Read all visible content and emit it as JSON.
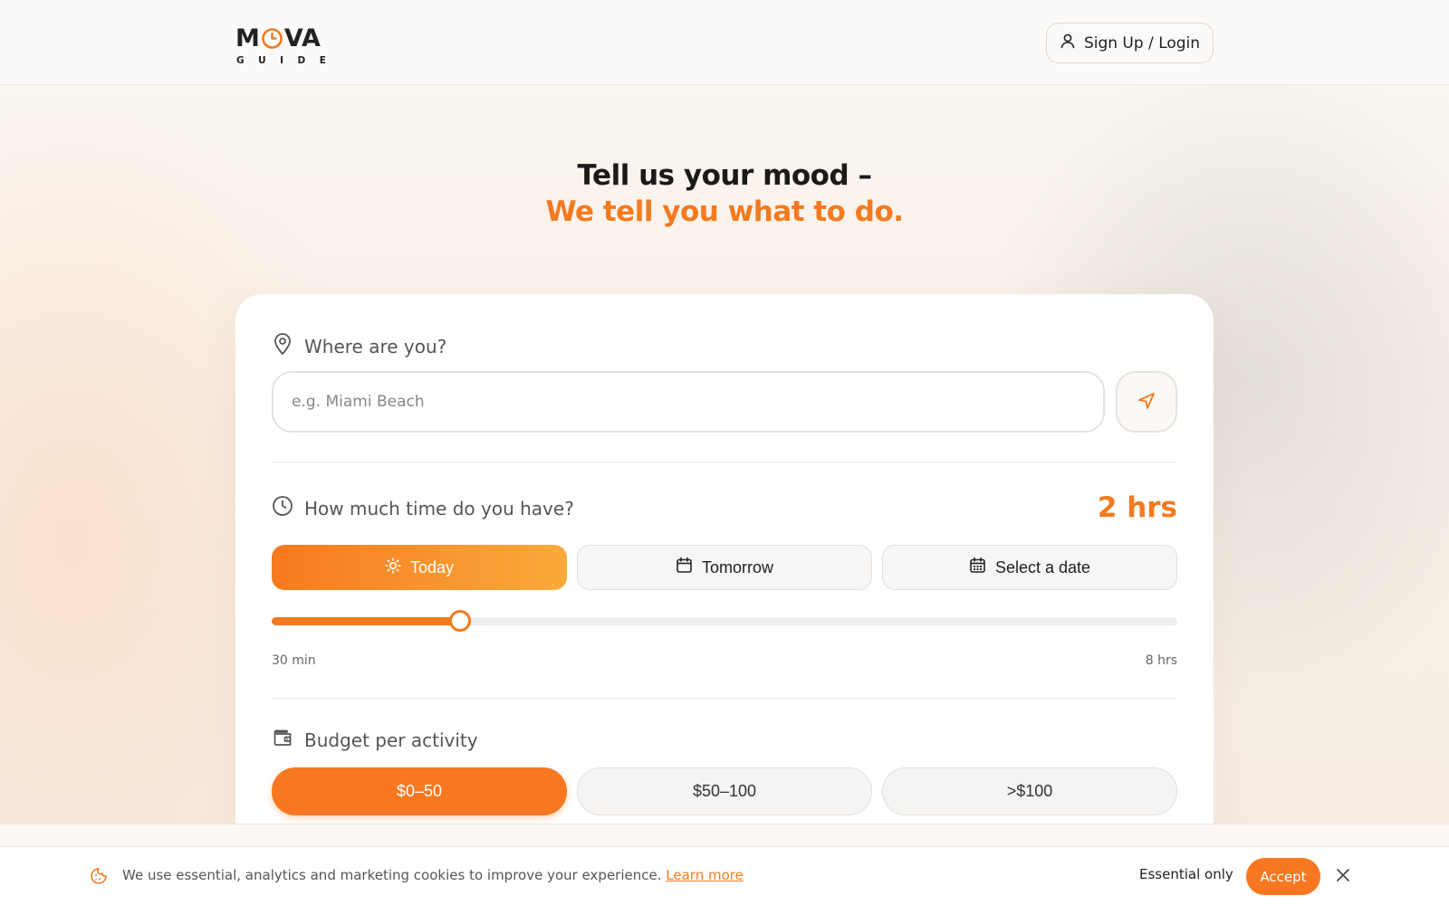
{
  "brand": {
    "logo_top_left": "M",
    "logo_top_right": "VA",
    "logo_bottom": "GUIDE",
    "accent": "#f47a20"
  },
  "header": {
    "login_label": "Sign Up / Login"
  },
  "hero": {
    "line1": "Tell us your mood –",
    "line2": "We tell you what to do."
  },
  "location": {
    "label": "Where are you?",
    "input_value": "",
    "placeholder": "e.g. Miami Beach"
  },
  "time": {
    "label": "How much time do you have?",
    "value_display": "2 hrs",
    "days": [
      {
        "label": "Today",
        "icon": "sun-icon",
        "active": true
      },
      {
        "label": "Tomorrow",
        "icon": "calendar-icon",
        "active": false
      },
      {
        "label": "Select a date",
        "icon": "calendar-grid-icon",
        "active": false
      }
    ],
    "slider": {
      "min_label": "30 min",
      "max_label": "8 hrs",
      "fraction": 0.208
    }
  },
  "budget": {
    "label": "Budget per activity",
    "options": [
      {
        "label": "$0–50",
        "active": true
      },
      {
        "label": "$50–100",
        "active": false
      },
      {
        "label": ">$100",
        "active": false
      }
    ]
  },
  "cookie": {
    "text": "We use essential, analytics and marketing cookies to improve your experience.",
    "link": "Learn more",
    "essential_label": "Essential only",
    "accept_label": "Accept"
  }
}
